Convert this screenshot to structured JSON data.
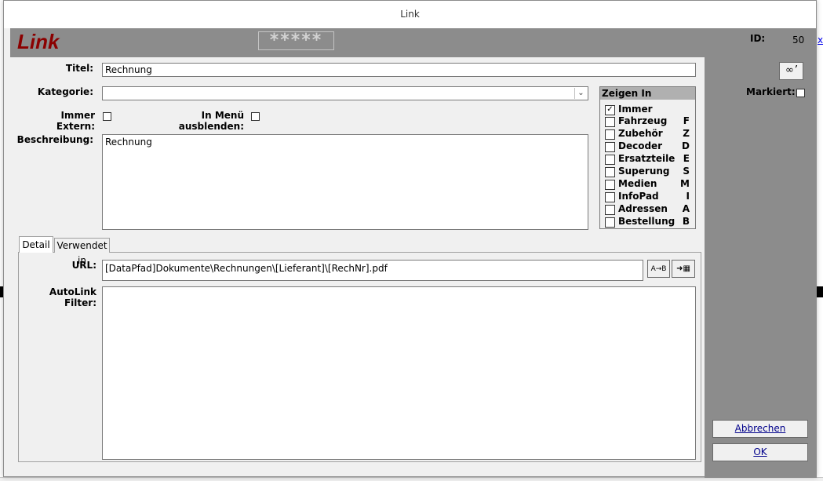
{
  "window": {
    "title": "Link"
  },
  "header": {
    "app_title": "Link",
    "rating": "*****",
    "id_label": "ID:",
    "id_value": "50"
  },
  "form": {
    "titel_label": "Titel:",
    "titel_value": "Rechnung",
    "kategorie_label": "Kategorie:",
    "kategorie_value": "",
    "immer_extern_label": "Immer Extern:",
    "in_menu_label": "In Menü ausblenden:",
    "beschreibung_label": "Beschreibung:",
    "beschreibung_value": "Rechnung"
  },
  "zeigen_in": {
    "header": "Zeigen In",
    "items": [
      {
        "label": "Immer",
        "letter": "",
        "checked": true
      },
      {
        "label": "Fahrzeug",
        "letter": "F",
        "checked": false
      },
      {
        "label": "Zubehör",
        "letter": "Z",
        "checked": false
      },
      {
        "label": "Decoder",
        "letter": "D",
        "checked": false
      },
      {
        "label": "Ersatzteile",
        "letter": "E",
        "checked": false
      },
      {
        "label": "Superung",
        "letter": "S",
        "checked": false
      },
      {
        "label": "Medien",
        "letter": "M",
        "checked": false
      },
      {
        "label": "InfoPad",
        "letter": "I",
        "checked": false
      },
      {
        "label": "Adressen",
        "letter": "A",
        "checked": false
      },
      {
        "label": "Bestellung",
        "letter": "B",
        "checked": false
      }
    ]
  },
  "tabs": [
    {
      "label": "Detail"
    },
    {
      "label": "Verwendet in"
    }
  ],
  "detail": {
    "url_label": "URL:",
    "url_value": "[DataPfad]Dokumente\\Rechnungen\\[Lieferant]\\[RechNr].pdf",
    "autolink_label": "AutoLink Filter:",
    "autolink_value": ""
  },
  "side": {
    "markiert_label": "Markiert:",
    "cancel_label": "Abbrechen",
    "ok_label": "OK",
    "binoculars_icon": "binoculars-icon",
    "url_button_icons": [
      "replace-placeholders-icon",
      "insert-field-icon"
    ]
  },
  "background": {
    "link_text": "x"
  },
  "colors": {
    "header_bg": "#8c8c8c",
    "app_title": "#8b0000",
    "button_text": "#00008b"
  }
}
